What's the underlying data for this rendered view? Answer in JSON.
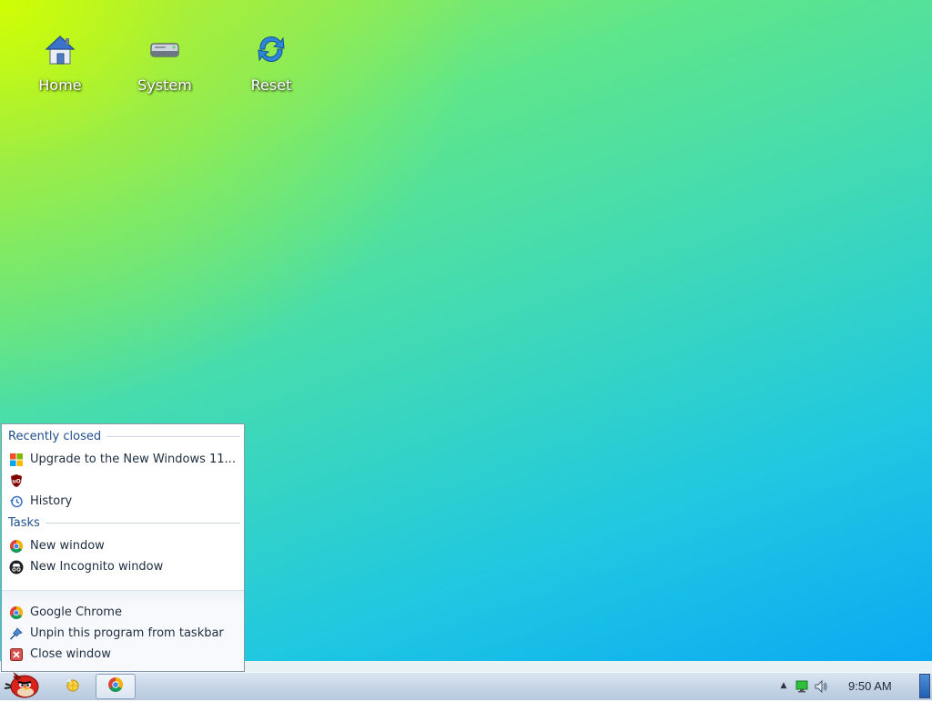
{
  "desktop": {
    "icons": [
      {
        "label": "Home",
        "icon": "home-icon"
      },
      {
        "label": "System",
        "icon": "drive-icon"
      },
      {
        "label": "Reset",
        "icon": "reset-icon"
      }
    ]
  },
  "jumplist": {
    "recently_closed_header": "Recently closed",
    "recent_items": [
      {
        "label": "Upgrade to the New Windows 11...",
        "icon": "windows-logo-icon"
      },
      {
        "label": "",
        "icon": "ublock-icon"
      },
      {
        "label": "History",
        "icon": "history-icon"
      }
    ],
    "tasks_header": "Tasks",
    "tasks": [
      {
        "label": "New window",
        "icon": "chrome-icon"
      },
      {
        "label": "New Incognito window",
        "icon": "incognito-icon"
      }
    ],
    "footer": [
      {
        "label": "Google Chrome",
        "icon": "chrome-icon"
      },
      {
        "label": "Unpin this program from taskbar",
        "icon": "unpin-icon"
      },
      {
        "label": "Close window",
        "icon": "close-window-icon"
      }
    ]
  },
  "taskbar": {
    "start_icon": "angry-bird-icon",
    "pinned": [
      {
        "app": "explorer",
        "icon": "folder-icon"
      },
      {
        "app": "chrome",
        "icon": "chrome-icon"
      }
    ],
    "tray": {
      "clock": "9:50 AM",
      "icons": [
        "show-hidden-icons-arrow",
        "network-icon",
        "volume-icon"
      ]
    }
  },
  "colors": {
    "desktop_gradient": [
      "#c8f40a",
      "#5fe68a",
      "#1fc7e1",
      "#0aa8f4"
    ],
    "jumplist_header": "#1e4f8c",
    "taskbar": "#c7d5e6"
  }
}
